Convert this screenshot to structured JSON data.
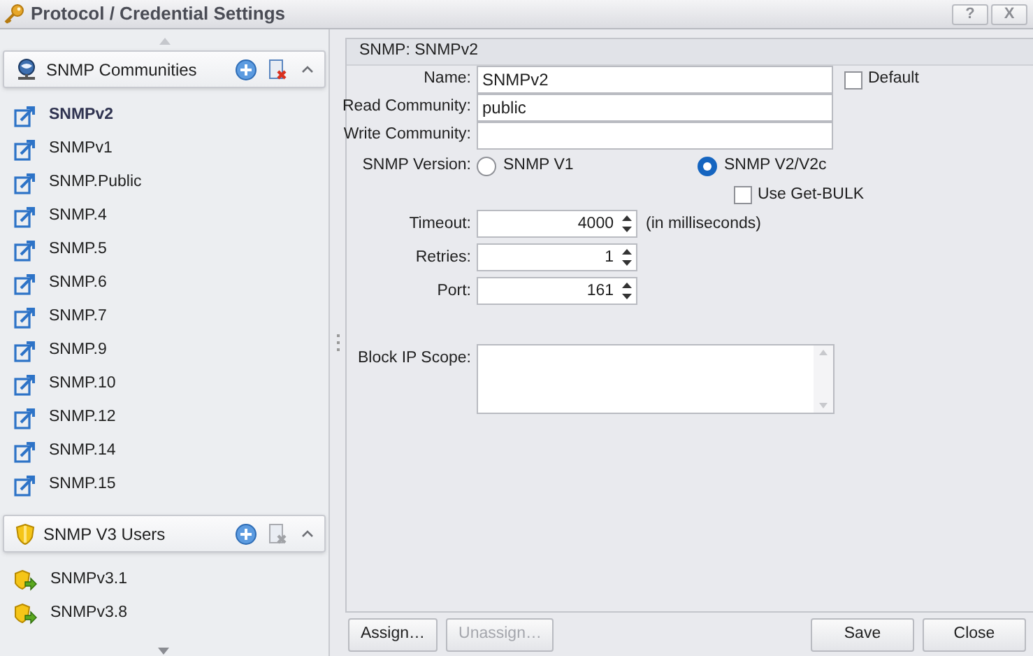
{
  "window": {
    "title": "Protocol / Credential Settings",
    "buttons": [
      "?",
      "X"
    ]
  },
  "sidebar": {
    "groups": [
      {
        "title": "SNMP Communities",
        "kind": "community",
        "remove_disabled": false,
        "items": [
          {
            "label": "SNMPv2",
            "selected": true
          },
          {
            "label": "SNMPv1",
            "selected": false
          },
          {
            "label": "SNMP.Public",
            "selected": false
          },
          {
            "label": "SNMP.4",
            "selected": false
          },
          {
            "label": "SNMP.5",
            "selected": false
          },
          {
            "label": "SNMP.6",
            "selected": false
          },
          {
            "label": "SNMP.7",
            "selected": false
          },
          {
            "label": "SNMP.9",
            "selected": false
          },
          {
            "label": "SNMP.10",
            "selected": false
          },
          {
            "label": "SNMP.12",
            "selected": false
          },
          {
            "label": "SNMP.14",
            "selected": false
          },
          {
            "label": "SNMP.15",
            "selected": false
          }
        ]
      },
      {
        "title": "SNMP V3 Users",
        "kind": "user",
        "remove_disabled": true,
        "items": [
          {
            "label": "SNMPv3.1",
            "selected": false
          },
          {
            "label": "SNMPv3.8",
            "selected": false
          }
        ]
      }
    ]
  },
  "detail": {
    "header": "SNMP: SNMPv2",
    "name": {
      "label": "Name:",
      "value": "SNMPv2"
    },
    "default": {
      "label": "Default",
      "checked": false
    },
    "read_community": {
      "label": "Read Community:",
      "value": "public"
    },
    "write_community": {
      "label": "Write Community:"
    },
    "version": {
      "label": "SNMP Version:",
      "options": [
        {
          "label": "SNMP V1",
          "selected": false
        },
        {
          "label": "SNMP V2/V2c",
          "selected": true
        }
      ]
    },
    "get_bulk": {
      "label": "Use Get-BULK",
      "checked": false
    },
    "timeout": {
      "label": "Timeout:",
      "value": "4000",
      "unit": "(in milliseconds)"
    },
    "retries": {
      "label": "Retries:",
      "value": "1"
    },
    "port": {
      "label": "Port:",
      "value": "161"
    },
    "block_ip_scope": {
      "label": "Block IP Scope:"
    }
  },
  "left_buttons": [
    {
      "label": "Assign…",
      "disabled": false
    },
    {
      "label": "Unassign…",
      "disabled": true
    }
  ],
  "right_buttons": [
    {
      "label": "Save",
      "disabled": false
    },
    {
      "label": "Close",
      "disabled": false
    }
  ]
}
